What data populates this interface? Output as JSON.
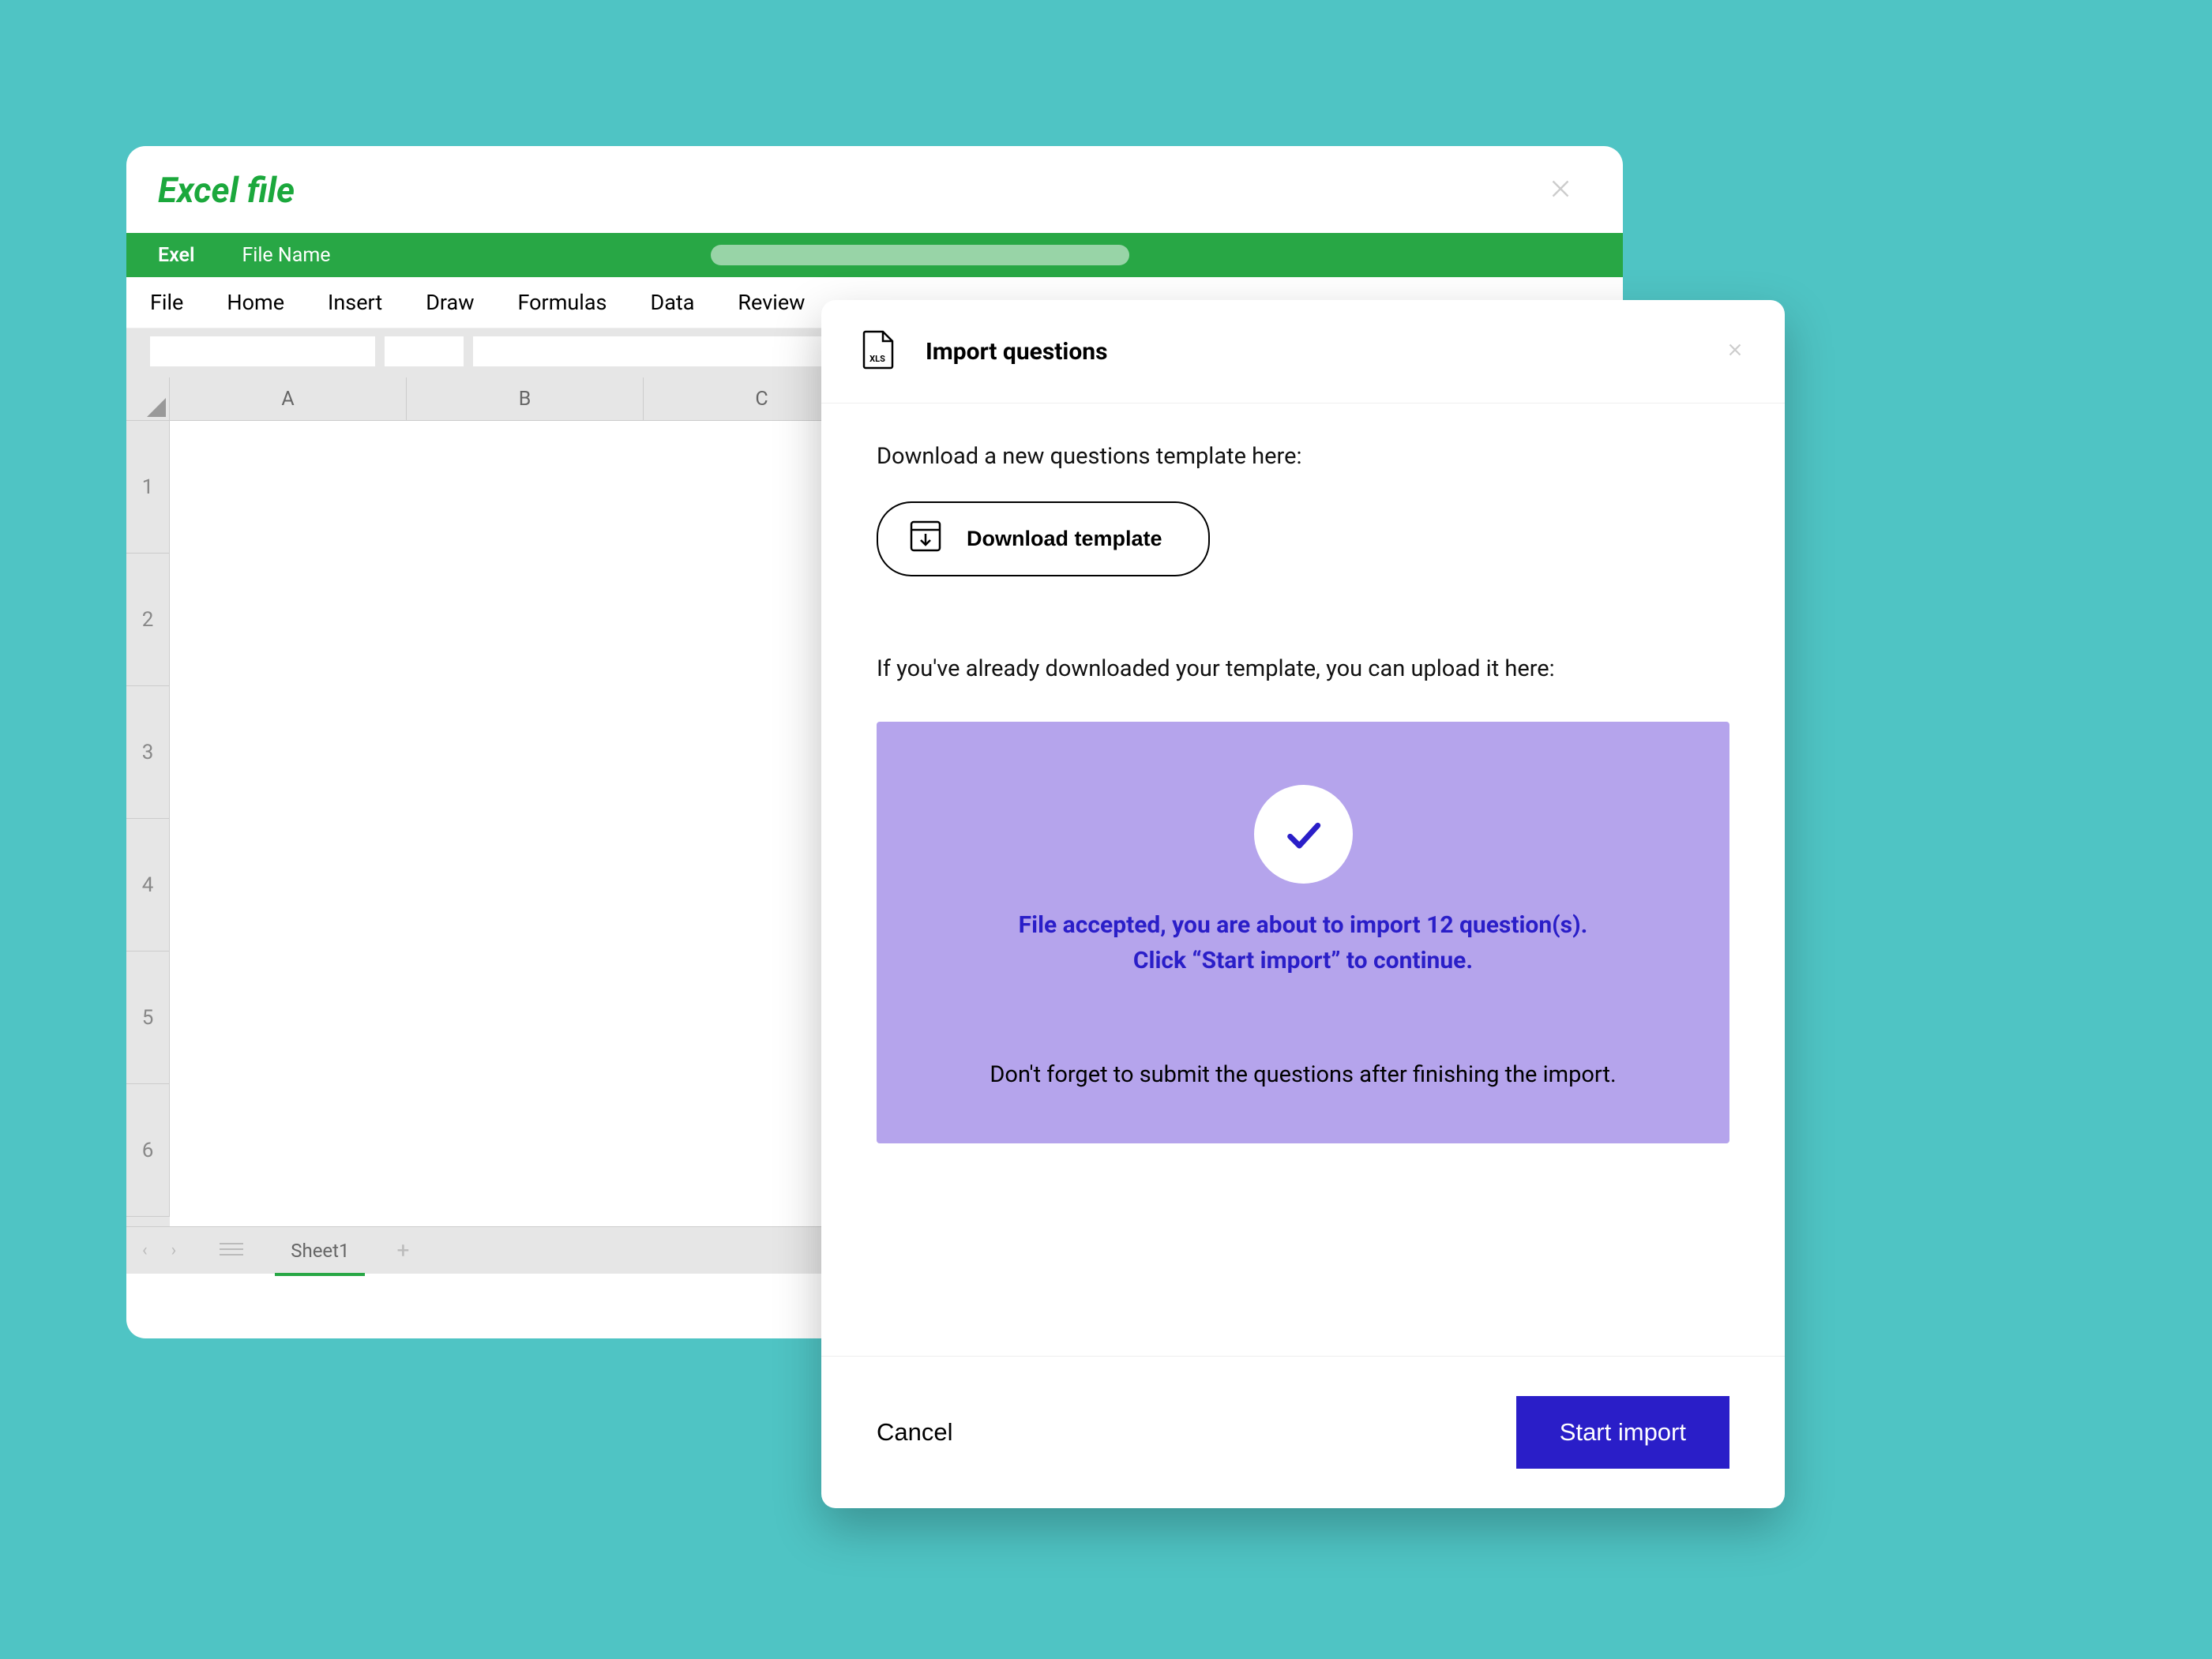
{
  "excel": {
    "title": "Excel file",
    "greenbar": {
      "app": "Exel",
      "filename": "File Name"
    },
    "ribbon": [
      "File",
      "Home",
      "Insert",
      "Draw",
      "Formulas",
      "Data",
      "Review"
    ],
    "columns": [
      "A",
      "B",
      "C"
    ],
    "rows": [
      "1",
      "2",
      "3",
      "4",
      "5",
      "6"
    ],
    "sheet_tab": "Sheet1"
  },
  "dialog": {
    "title": "Import questions",
    "download_prompt": "Download a new questions template here:",
    "download_button": "Download template",
    "upload_prompt": "If you've already downloaded your template, you can upload it here:",
    "accepted_line1": "File accepted, you are about to import 12 question(s).",
    "accepted_line2": "Click “Start import” to continue.",
    "reminder": "Don't forget to submit the questions after finishing the import.",
    "cancel": "Cancel",
    "start": "Start import"
  }
}
